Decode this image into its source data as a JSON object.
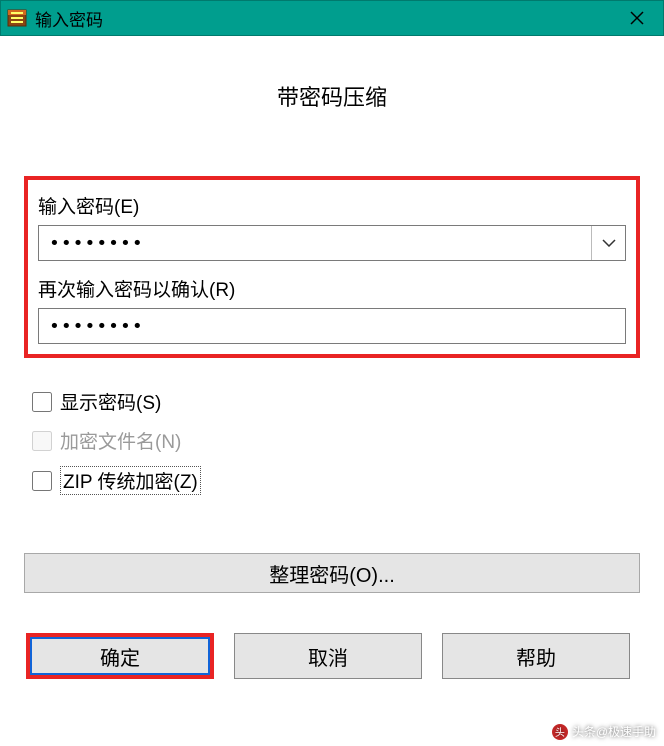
{
  "titlebar": {
    "title": "输入密码"
  },
  "heading": "带密码压缩",
  "password_section": {
    "enter_label": "输入密码(E)",
    "enter_value": "••••••••",
    "confirm_label": "再次输入密码以确认(R)",
    "confirm_value": "••••••••"
  },
  "checkboxes": {
    "show_password": {
      "label": "显示密码(S)",
      "checked": false,
      "enabled": true
    },
    "encrypt_names": {
      "label": "加密文件名(N)",
      "checked": false,
      "enabled": false
    },
    "zip_legacy": {
      "label": "ZIP 传统加密(Z)",
      "checked": false,
      "enabled": true
    }
  },
  "buttons": {
    "organize": "整理密码(O)...",
    "ok": "确定",
    "cancel": "取消",
    "help": "帮助"
  },
  "watermark": "头条@极速手助"
}
